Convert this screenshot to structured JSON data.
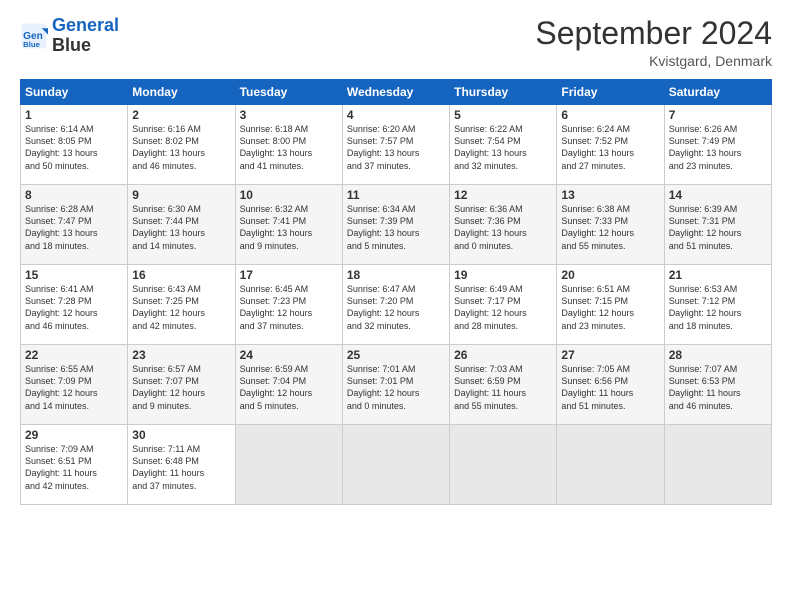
{
  "header": {
    "logo_line1": "General",
    "logo_line2": "Blue",
    "month_title": "September 2024",
    "location": "Kvistgard, Denmark"
  },
  "weekdays": [
    "Sunday",
    "Monday",
    "Tuesday",
    "Wednesday",
    "Thursday",
    "Friday",
    "Saturday"
  ],
  "weeks": [
    [
      {
        "day": "1",
        "info": "Sunrise: 6:14 AM\nSunset: 8:05 PM\nDaylight: 13 hours\nand 50 minutes."
      },
      {
        "day": "2",
        "info": "Sunrise: 6:16 AM\nSunset: 8:02 PM\nDaylight: 13 hours\nand 46 minutes."
      },
      {
        "day": "3",
        "info": "Sunrise: 6:18 AM\nSunset: 8:00 PM\nDaylight: 13 hours\nand 41 minutes."
      },
      {
        "day": "4",
        "info": "Sunrise: 6:20 AM\nSunset: 7:57 PM\nDaylight: 13 hours\nand 37 minutes."
      },
      {
        "day": "5",
        "info": "Sunrise: 6:22 AM\nSunset: 7:54 PM\nDaylight: 13 hours\nand 32 minutes."
      },
      {
        "day": "6",
        "info": "Sunrise: 6:24 AM\nSunset: 7:52 PM\nDaylight: 13 hours\nand 27 minutes."
      },
      {
        "day": "7",
        "info": "Sunrise: 6:26 AM\nSunset: 7:49 PM\nDaylight: 13 hours\nand 23 minutes."
      }
    ],
    [
      {
        "day": "8",
        "info": "Sunrise: 6:28 AM\nSunset: 7:47 PM\nDaylight: 13 hours\nand 18 minutes."
      },
      {
        "day": "9",
        "info": "Sunrise: 6:30 AM\nSunset: 7:44 PM\nDaylight: 13 hours\nand 14 minutes."
      },
      {
        "day": "10",
        "info": "Sunrise: 6:32 AM\nSunset: 7:41 PM\nDaylight: 13 hours\nand 9 minutes."
      },
      {
        "day": "11",
        "info": "Sunrise: 6:34 AM\nSunset: 7:39 PM\nDaylight: 13 hours\nand 5 minutes."
      },
      {
        "day": "12",
        "info": "Sunrise: 6:36 AM\nSunset: 7:36 PM\nDaylight: 13 hours\nand 0 minutes."
      },
      {
        "day": "13",
        "info": "Sunrise: 6:38 AM\nSunset: 7:33 PM\nDaylight: 12 hours\nand 55 minutes."
      },
      {
        "day": "14",
        "info": "Sunrise: 6:39 AM\nSunset: 7:31 PM\nDaylight: 12 hours\nand 51 minutes."
      }
    ],
    [
      {
        "day": "15",
        "info": "Sunrise: 6:41 AM\nSunset: 7:28 PM\nDaylight: 12 hours\nand 46 minutes."
      },
      {
        "day": "16",
        "info": "Sunrise: 6:43 AM\nSunset: 7:25 PM\nDaylight: 12 hours\nand 42 minutes."
      },
      {
        "day": "17",
        "info": "Sunrise: 6:45 AM\nSunset: 7:23 PM\nDaylight: 12 hours\nand 37 minutes."
      },
      {
        "day": "18",
        "info": "Sunrise: 6:47 AM\nSunset: 7:20 PM\nDaylight: 12 hours\nand 32 minutes."
      },
      {
        "day": "19",
        "info": "Sunrise: 6:49 AM\nSunset: 7:17 PM\nDaylight: 12 hours\nand 28 minutes."
      },
      {
        "day": "20",
        "info": "Sunrise: 6:51 AM\nSunset: 7:15 PM\nDaylight: 12 hours\nand 23 minutes."
      },
      {
        "day": "21",
        "info": "Sunrise: 6:53 AM\nSunset: 7:12 PM\nDaylight: 12 hours\nand 18 minutes."
      }
    ],
    [
      {
        "day": "22",
        "info": "Sunrise: 6:55 AM\nSunset: 7:09 PM\nDaylight: 12 hours\nand 14 minutes."
      },
      {
        "day": "23",
        "info": "Sunrise: 6:57 AM\nSunset: 7:07 PM\nDaylight: 12 hours\nand 9 minutes."
      },
      {
        "day": "24",
        "info": "Sunrise: 6:59 AM\nSunset: 7:04 PM\nDaylight: 12 hours\nand 5 minutes."
      },
      {
        "day": "25",
        "info": "Sunrise: 7:01 AM\nSunset: 7:01 PM\nDaylight: 12 hours\nand 0 minutes."
      },
      {
        "day": "26",
        "info": "Sunrise: 7:03 AM\nSunset: 6:59 PM\nDaylight: 11 hours\nand 55 minutes."
      },
      {
        "day": "27",
        "info": "Sunrise: 7:05 AM\nSunset: 6:56 PM\nDaylight: 11 hours\nand 51 minutes."
      },
      {
        "day": "28",
        "info": "Sunrise: 7:07 AM\nSunset: 6:53 PM\nDaylight: 11 hours\nand 46 minutes."
      }
    ],
    [
      {
        "day": "29",
        "info": "Sunrise: 7:09 AM\nSunset: 6:51 PM\nDaylight: 11 hours\nand 42 minutes."
      },
      {
        "day": "30",
        "info": "Sunrise: 7:11 AM\nSunset: 6:48 PM\nDaylight: 11 hours\nand 37 minutes."
      },
      {
        "day": "",
        "info": ""
      },
      {
        "day": "",
        "info": ""
      },
      {
        "day": "",
        "info": ""
      },
      {
        "day": "",
        "info": ""
      },
      {
        "day": "",
        "info": ""
      }
    ]
  ]
}
